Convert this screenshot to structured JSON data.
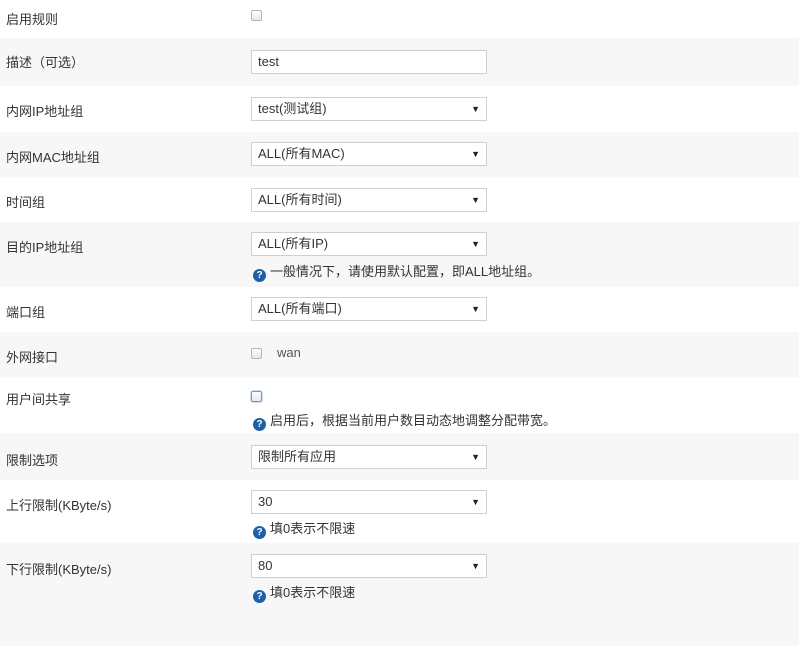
{
  "rows": [
    {
      "id": "enable-rule",
      "label": "启用规则"
    },
    {
      "id": "description",
      "label": "描述（可选）",
      "value": "test"
    },
    {
      "id": "lan-ip-group",
      "label": "内网IP地址组",
      "selected": "test(测试组)"
    },
    {
      "id": "lan-mac-group",
      "label": "内网MAC地址组",
      "selected": "ALL(所有MAC)"
    },
    {
      "id": "time-group",
      "label": "时间组",
      "selected": "ALL(所有时间)"
    },
    {
      "id": "dest-ip-group",
      "label": "目的IP地址组",
      "selected": "ALL(所有IP)",
      "help": "一般情况下，请使用默认配置，即ALL地址组。"
    },
    {
      "id": "port-group",
      "label": "端口组",
      "selected": "ALL(所有端口)"
    },
    {
      "id": "wan-interface",
      "label": "外网接口",
      "option": "wan"
    },
    {
      "id": "user-sharing",
      "label": "用户间共享",
      "help": "启用后，根据当前用户数目动态地调整分配带宽。"
    },
    {
      "id": "limit-option",
      "label": "限制选项",
      "selected": "限制所有应用"
    },
    {
      "id": "upload-limit",
      "label": "上行限制(KByte/s)",
      "selected": "30",
      "help": "填0表示不限速"
    },
    {
      "id": "download-limit",
      "label": "下行限制(KByte/s)",
      "selected": "80",
      "help": "填0表示不限速"
    }
  ],
  "icons": {
    "help": "question-circle-icon",
    "dropdown": "caret-down-icon"
  },
  "colors": {
    "help_icon": "#1f5fa8",
    "alt_row": "#f7f7f7"
  }
}
